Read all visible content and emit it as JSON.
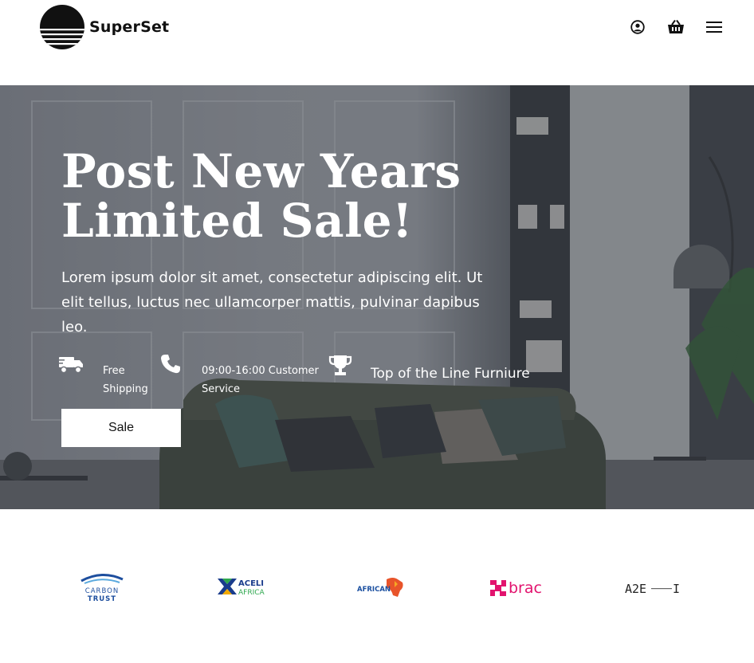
{
  "header": {
    "brand": "SuperSet",
    "icons": [
      "user-circle-icon",
      "basket-icon",
      "hamburger-menu-icon"
    ]
  },
  "hero": {
    "title_line1": "Post New Years",
    "title_line2": "Limited Sale!",
    "text": "Lorem ipsum dolor sit amet, consectetur adipiscing elit. Ut elit tellus, luctus nec ullamcorper mattis, pulvinar dapibus leo.",
    "features": [
      {
        "icon": "truck-icon",
        "line1": "Free",
        "line2": "Shipping"
      },
      {
        "icon": "phone-icon",
        "line1": "09:00-16:00 Customer",
        "line2": "Service"
      },
      {
        "icon": "trophy-icon",
        "label": "Top of the Line Furniure"
      }
    ],
    "button": "Sale"
  },
  "partners": {
    "carbon_line1": "CARBON",
    "carbon_line2": "TRUST",
    "aceli_line1": "ACELI",
    "aceli_line2": "AFRICA",
    "african": "AFRICAN",
    "brac": "brac",
    "a2e": "A2E",
    "a2e_end": "I"
  },
  "colors": {
    "brac_pink": "#e2136e",
    "aceli_green": "#2fa84f",
    "aceli_blue": "#1a3c8c",
    "carbon_blue": "#1d4e9e",
    "african_orange": "#e8542a"
  }
}
